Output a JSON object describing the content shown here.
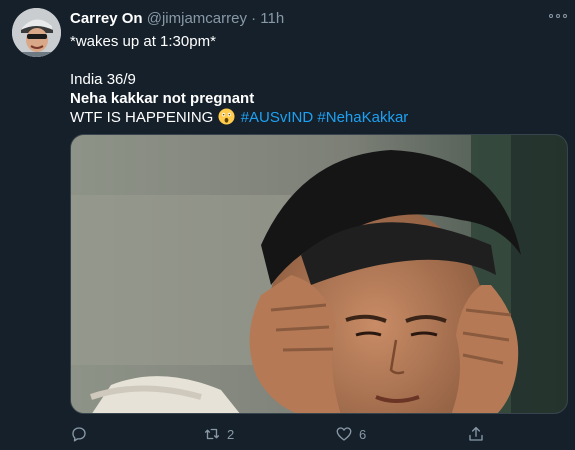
{
  "tweet": {
    "author": {
      "display_name": "Carrey On",
      "handle": "@jimjamcarrey",
      "separator": "·",
      "timestamp": "11h",
      "avatar_icon": "avatar-photo"
    },
    "lines": {
      "line1": "*wakes up at 1:30pm*",
      "line2": "India 36/9",
      "line3": "Neha kakkar not pregnant",
      "line4_text": "WTF IS HAPPENING",
      "line4_emoji": "astonished-face-emoji",
      "hashtag1": "#AUSvIND",
      "hashtag2": "#NehaKakkar"
    },
    "media": {
      "type": "image",
      "icon": "photo-of-man-holding-head"
    },
    "actions": {
      "reply_icon": "reply-icon",
      "reply_count": "",
      "retweet_icon": "retweet-icon",
      "retweet_count": "2",
      "like_icon": "heart-icon",
      "like_count": "6",
      "share_icon": "share-icon"
    },
    "more_icon": "more-options-icon"
  },
  "colors": {
    "background": "#15202b",
    "text": "#ffffff",
    "muted": "#8899a6",
    "link": "#1da1f2",
    "border": "#38444d"
  }
}
